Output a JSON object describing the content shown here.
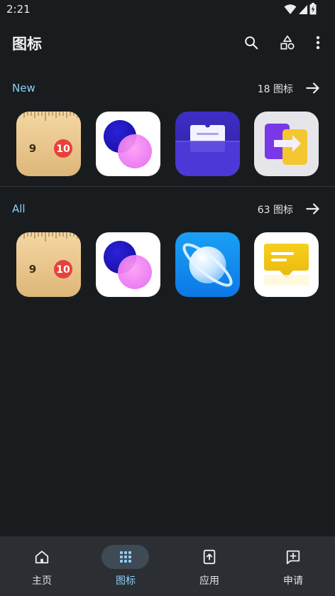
{
  "status_bar": {
    "time": "2:21",
    "icons": [
      "wifi-icon",
      "signal-icon",
      "battery-charging-icon"
    ]
  },
  "app_bar": {
    "title": "图标",
    "actions": [
      "search-icon",
      "shapes-icon",
      "more-vert-icon"
    ]
  },
  "sections": [
    {
      "name": "New",
      "count_label": "18 图标",
      "icons": [
        "ruler-app-icon",
        "blend-circles-app-icon",
        "wallet-app-icon",
        "switch-app-app-icon"
      ]
    },
    {
      "name": "All",
      "count_label": "63 图标",
      "icons": [
        "ruler-app-icon",
        "blend-circles-app-icon",
        "planet-browser-app-icon",
        "message-app-icon"
      ]
    }
  ],
  "ruler_numbers": {
    "left": "9",
    "right": "10"
  },
  "bottom_nav": {
    "items": [
      {
        "label": "主页",
        "icon": "home-icon",
        "active": false
      },
      {
        "label": "图标",
        "icon": "grid-icon",
        "active": true
      },
      {
        "label": "应用",
        "icon": "tablet-upload-icon",
        "active": false
      },
      {
        "label": "申请",
        "icon": "add-message-icon",
        "active": false
      }
    ]
  },
  "colors": {
    "background": "#191c1e",
    "accent": "#8fcff7",
    "nav_background": "#2b2f33"
  }
}
